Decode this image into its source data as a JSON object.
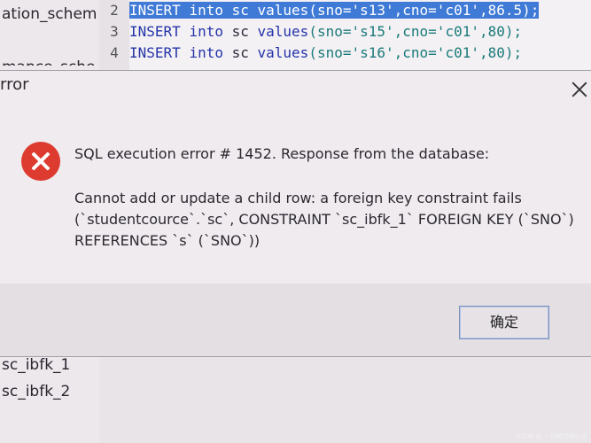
{
  "background": {
    "left_panel_items": [
      "ation_schem",
      "mance_sche",
      "sc_ibfk_1",
      "sc_ibfk_2"
    ],
    "code_lines": [
      {
        "num": "2",
        "kw1": "INSERT",
        "kw2": "into",
        "tbl": "sc",
        "kw3": "values",
        "args": "(sno='s13',cno='c01',86.5);",
        "selected": true
      },
      {
        "num": "3",
        "kw1": "INSERT",
        "kw2": "into",
        "tbl": "sc",
        "kw3": "values",
        "args": "(sno='s15',cno='c01',80);",
        "selected": false
      },
      {
        "num": "4",
        "kw1": "INSERT",
        "kw2": "into",
        "tbl": "sc",
        "kw3": "values",
        "args": "(sno='s16',cno='c01',80);",
        "selected": false
      }
    ]
  },
  "dialog": {
    "title": "rror",
    "icon": "error-circle-x",
    "heading": "SQL execution error # 1452. Response from the database:",
    "detail_lines": [
      "Cannot add or update a child row: a foreign key constraint fails",
      "(`studentcource`.`sc`, CONSTRAINT `sc_ibfk_1` FOREIGN KEY (`SNO`)",
      "REFERENCES `s` (`SNO`))"
    ],
    "ok_label": "确定"
  },
  "colors": {
    "selection": "#3f7ad6",
    "error_icon": "#dd3b2f",
    "button_border": "#7a8fbf"
  },
  "watermark": "CSDN @ 一只努力的小白"
}
